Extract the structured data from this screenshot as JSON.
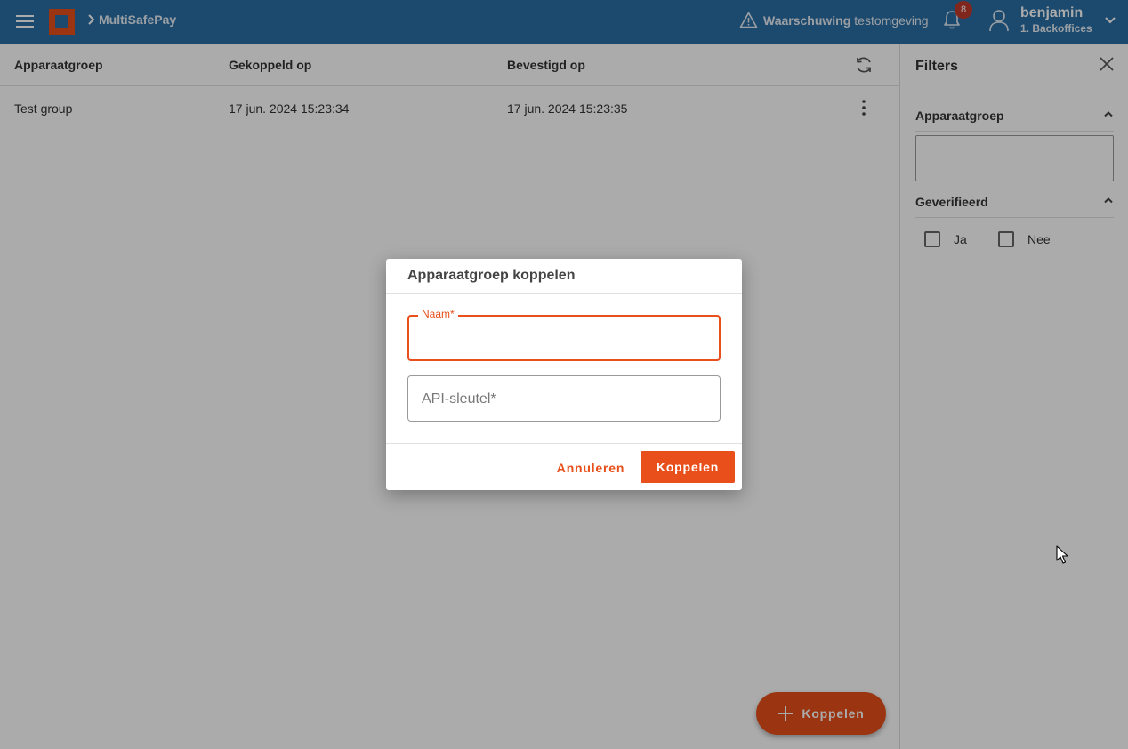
{
  "header": {
    "breadcrumb": "MultiSafePay",
    "warning_strong": "Waarschuwing",
    "warning_text": "testomgeving",
    "notifications_count": "8",
    "user_name": "benjamin",
    "user_org": "1. Backoffices",
    "brand_color": "#e84f1a",
    "bar_color": "#2a6fa6"
  },
  "table": {
    "columns": [
      "Apparaatgroep",
      "Gekoppeld op",
      "Bevestigd op"
    ],
    "rows": [
      {
        "group": "Test group",
        "linked": "17 jun. 2024 15:23:34",
        "confirmed": "17 jun. 2024 15:23:35"
      }
    ]
  },
  "filters": {
    "title": "Filters",
    "group_section": "Apparaatgroep",
    "group_value": "",
    "verified_section": "Geverifieerd",
    "options": [
      "Ja",
      "Nee"
    ]
  },
  "fab": {
    "label": "Koppelen"
  },
  "dialog": {
    "title": "Apparaatgroep koppelen",
    "name_label": "Naam*",
    "name_value": "",
    "api_placeholder": "API-sleutel*",
    "cancel_label": "Annuleren",
    "submit_label": "Koppelen"
  }
}
